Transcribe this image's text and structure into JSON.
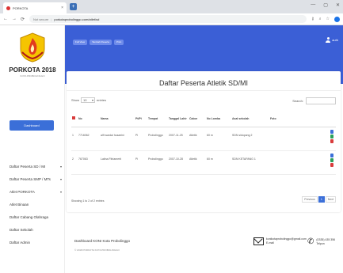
{
  "browser": {
    "tab_title": "PORKOTA",
    "url_warning": "Not secure",
    "url": "porkotaprobolinggo.com/atlet/sd",
    "new_tab": "+",
    "back": "←",
    "forward": "→",
    "reload": "⟳",
    "close": "×",
    "window": [
      "—",
      "▢",
      "✕"
    ]
  },
  "sidebar": {
    "brand": "PORKOTA 2018",
    "brand_sub": "KOTA PROBOLINGGO",
    "dashboard_label": "Dashboard",
    "items": [
      {
        "label": "Daftar Peserta SD / MI",
        "chevron": "▾"
      },
      {
        "label": "Daftar Peserta SMP / MTs",
        "chevron": "▾"
      },
      {
        "label": "Atlet PORKOTA",
        "chevron": "▾"
      },
      {
        "label": "Atlet Binaan",
        "chevron": ""
      },
      {
        "label": "Daftar Cabang Olahraga",
        "chevron": ""
      },
      {
        "label": "Daftar Sekolah",
        "chevron": ""
      },
      {
        "label": "Daftar Admin",
        "chevron": ""
      }
    ]
  },
  "header": {
    "buttons": [
      "Full View",
      "Tambah Peserta",
      "Print"
    ],
    "user": "auth"
  },
  "main": {
    "title": "Daftar Peserta Atletik SD/MI",
    "show_label": "Show",
    "show_value": "10",
    "entries_label": "entries",
    "search_label": "Search:",
    "columns": [
      "No",
      "Nama",
      "Pt/Pi",
      "Tempat",
      "Tanggal Lahir",
      "Cabor",
      "No Lomba",
      "Asal sekolah",
      "Foto"
    ],
    "rows": [
      [
        "1",
        "7716062",
        "alfi wardai husaeini",
        "Pi",
        "Probolinggo",
        "2007-11-25",
        "Atletik",
        "60 m",
        "SDN sidopang 2",
        ""
      ],
      [
        "2",
        "767063",
        "Latina Fitriamerti",
        "Pi",
        "Probolinggo",
        "2007-10-28",
        "Atletik",
        "60 m",
        "SDN KETAPANG 1",
        ""
      ]
    ],
    "showing": "Showing 1 to 2 of 2 entries",
    "pager": [
      "Previous",
      "1",
      "Next"
    ]
  },
  "footer": {
    "title": "Dashboard KONI Kota Probolinggo",
    "copyright": "© 2018 PORKOTA KOTA PROBOLINGGO",
    "email": "konikotaprobolinggo@gmail.com",
    "email_label": "E-mail",
    "phone": "(0335) 435 356",
    "phone_label": "Telpon"
  },
  "colors": {
    "primary": "#3b5fd6",
    "accent": "#3b6fd8",
    "danger": "#d93c3c",
    "success": "#2aa05a"
  }
}
